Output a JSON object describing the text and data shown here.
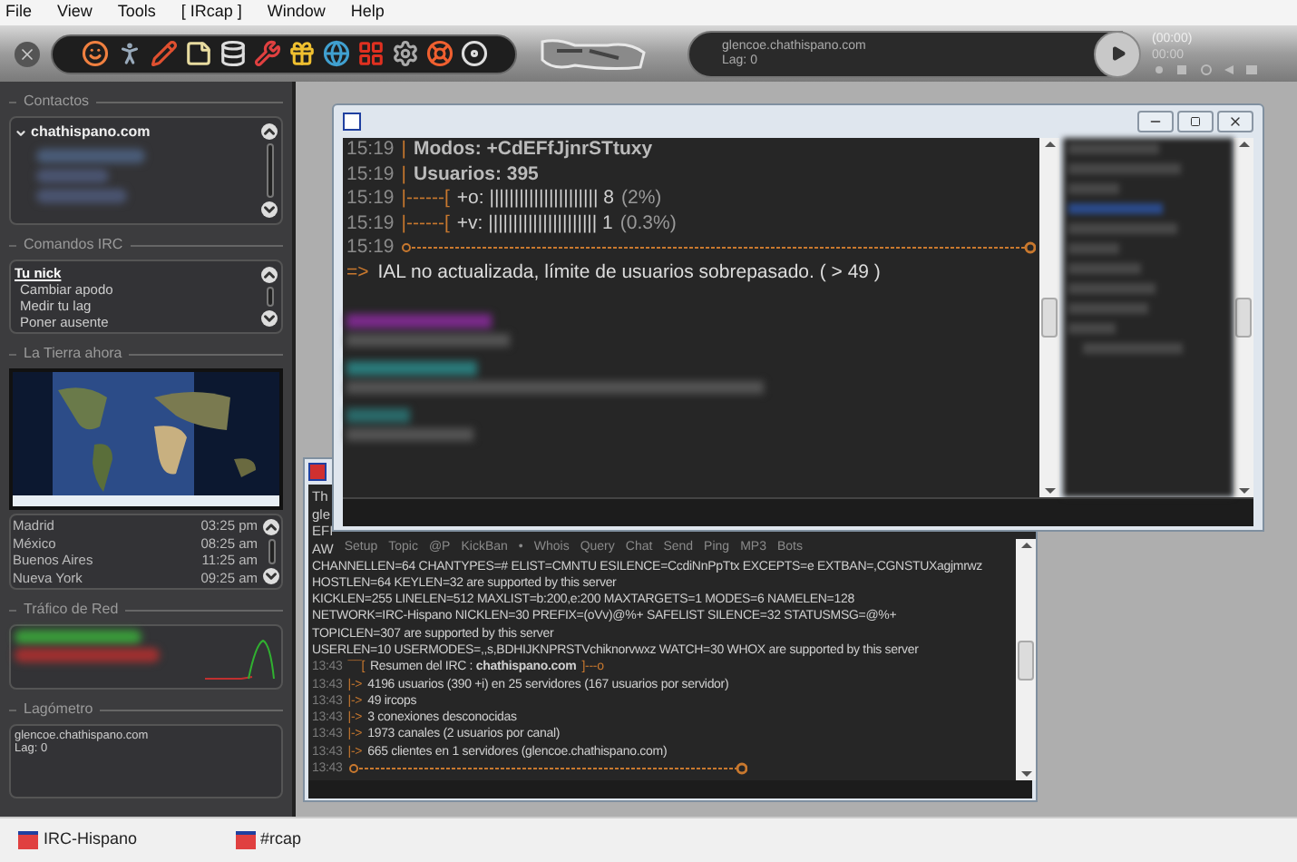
{
  "menu": [
    "File",
    "View",
    "Tools",
    "[ IRcap ]",
    "Window",
    "Help"
  ],
  "toolbar": {
    "status": {
      "server": "glencoe.chathispano.com",
      "lag": "Lag: 0"
    },
    "player": {
      "elapsed": "(00:00)",
      "time": "00:00"
    }
  },
  "sidebar": {
    "contacts": {
      "title": "Contactos",
      "network": "chathispano.com",
      "expanded": true
    },
    "commands": {
      "title": "Comandos IRC",
      "items": [
        {
          "label": "Tu nick",
          "kind": "heading"
        },
        {
          "label": "Cambiar apodo",
          "kind": "command"
        },
        {
          "label": "Medir tu lag",
          "kind": "command"
        },
        {
          "label": "Poner ausente",
          "kind": "command"
        }
      ]
    },
    "earth": {
      "title": "La Tierra ahora",
      "clocks": [
        {
          "city": "Madrid",
          "time": "03:25 pm"
        },
        {
          "city": "México",
          "time": "08:25 am"
        },
        {
          "city": "Buenos Aires",
          "time": "11:25 am"
        },
        {
          "city": "Nueva York",
          "time": "09:25 am"
        }
      ]
    },
    "traffic": {
      "title": "Tráfico de Red"
    },
    "lagometer": {
      "title": "Lagómetro",
      "server": "glencoe.chathispano.com",
      "lag": "Lag: 0"
    }
  },
  "channel_window": {
    "lines": [
      {
        "time": "15:19",
        "kind": "field",
        "sep": "|",
        "text": "Modos: +CdEFfJjnrSTtuxy"
      },
      {
        "time": "15:19",
        "kind": "field",
        "sep": "|",
        "text": "Usuarios: 395"
      },
      {
        "time": "15:19",
        "kind": "bar",
        "sep": "|------[",
        "text": "+o: |||||||||||||||||||||| 8",
        "extra": "(2%)"
      },
      {
        "time": "15:19",
        "kind": "bar",
        "sep": "|------[",
        "text": "+v: |||||||||||||||||||||| 1",
        "extra": "(0.3%)"
      },
      {
        "time": "15:19",
        "kind": "rule"
      }
    ],
    "notice": {
      "prefix": "=>",
      "text": "IAL no actualizada, límite de usuarios sobrepasado. ( > 49 )"
    }
  },
  "status_window": {
    "cut_lines": [
      "Th",
      "gle",
      "EFI",
      "AW"
    ],
    "toolbar": [
      "Setup",
      "Topic",
      "@P",
      "KickBan",
      "•",
      "Whois",
      "Query",
      "Chat",
      "Send",
      "Ping",
      "MP3",
      "Bots"
    ],
    "lines": [
      {
        "kind": "plain",
        "text": "CHANNELLEN=64 CHANTYPES=# ELIST=CMNTU ESILENCE=CcdiNnPpTtx EXCEPTS=e EXTBAN=,CGNSTUXagjmrwz"
      },
      {
        "kind": "plain",
        "text": "HOSTLEN=64 KEYLEN=32 are supported by this server"
      },
      {
        "kind": "plain",
        "text": "KICKLEN=255 LINELEN=512 MAXLIST=b:200,e:200 MAXTARGETS=1 MODES=6 NAMELEN=128"
      },
      {
        "kind": "plain",
        "text": "NETWORK=IRC-Hispano NICKLEN=30 PREFIX=(oVv)@%+ SAFELIST SILENCE=32 STATUSMSG=@%+"
      },
      {
        "kind": "plain",
        "text": "TOPICLEN=307 are supported by this server"
      },
      {
        "kind": "plain",
        "text": "USERLEN=10 USERMODES=,,s,BDHIJKNPRSTVchiknorvwxz WATCH=30 WHOX are supported by this server"
      },
      {
        "kind": "header",
        "time": "13:43",
        "sep": "¯¯[",
        "text": "Resumen del IRC : **chathispano.com**",
        "tail": "]---o"
      },
      {
        "kind": "item",
        "time": "13:43",
        "sep": "|->",
        "text": "4196 usuarios (390 +i) en 25 servidores (167 usuarios por servidor)"
      },
      {
        "kind": "item",
        "time": "13:43",
        "sep": "|->",
        "text": "49 ircops"
      },
      {
        "kind": "item",
        "time": "13:43",
        "sep": "|->",
        "text": "3 conexiones desconocidas"
      },
      {
        "kind": "item",
        "time": "13:43",
        "sep": "|->",
        "text": "1973 canales (2 usuarios por canal)"
      },
      {
        "kind": "item",
        "time": "13:43",
        "sep": "|->",
        "text": "665 clientes en 1 servidores (glencoe.chathispano.com)"
      },
      {
        "kind": "rule",
        "time": "13:43"
      }
    ]
  },
  "taskbar": [
    {
      "label": "IRC-Hispano",
      "selected": false
    },
    {
      "label": "#rcap",
      "selected": false
    }
  ]
}
